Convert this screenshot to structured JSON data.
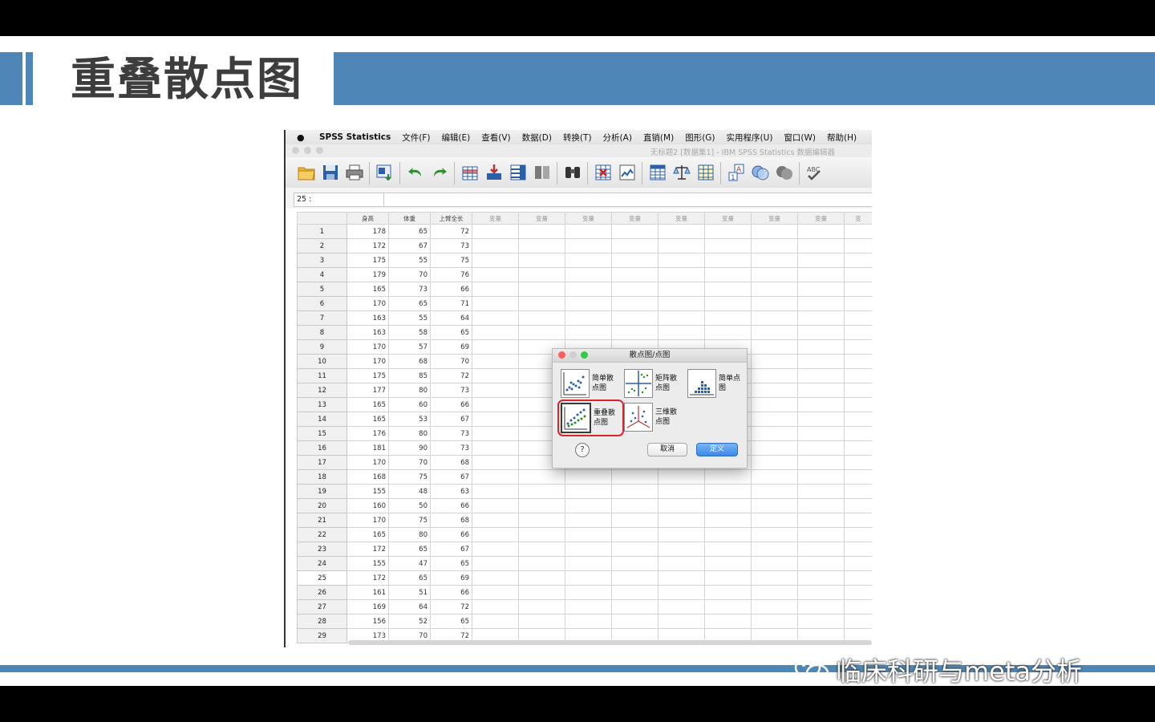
{
  "slide": {
    "title": "重叠散点图",
    "watermark": "临床科研与meta分析"
  },
  "menubar": {
    "app": "SPSS Statistics",
    "items": [
      "文件(F)",
      "编辑(E)",
      "查看(V)",
      "数据(D)",
      "转换(T)",
      "分析(A)",
      "直销(M)",
      "图形(G)",
      "实用程序(U)",
      "窗口(W)",
      "帮助(H)"
    ]
  },
  "window": {
    "title": "无标题2 [数据集1] - IBM SPSS Statistics 数据编辑器"
  },
  "cell_ref": "25 :",
  "grid": {
    "headers": [
      "身高",
      "体重",
      "上臂全长",
      "变量",
      "变量",
      "变量",
      "变量",
      "变量",
      "变量",
      "变量",
      "变量",
      "变"
    ],
    "active_row": "25",
    "rows": [
      {
        "n": "1",
        "v": [
          "178",
          "65",
          "72"
        ]
      },
      {
        "n": "2",
        "v": [
          "172",
          "67",
          "73"
        ]
      },
      {
        "n": "3",
        "v": [
          "175",
          "55",
          "75"
        ]
      },
      {
        "n": "4",
        "v": [
          "179",
          "70",
          "76"
        ]
      },
      {
        "n": "5",
        "v": [
          "165",
          "73",
          "66"
        ]
      },
      {
        "n": "6",
        "v": [
          "170",
          "65",
          "71"
        ]
      },
      {
        "n": "7",
        "v": [
          "163",
          "55",
          "64"
        ]
      },
      {
        "n": "8",
        "v": [
          "163",
          "58",
          "65"
        ]
      },
      {
        "n": "9",
        "v": [
          "170",
          "57",
          "69"
        ]
      },
      {
        "n": "10",
        "v": [
          "170",
          "68",
          "70"
        ]
      },
      {
        "n": "11",
        "v": [
          "175",
          "85",
          "72"
        ]
      },
      {
        "n": "12",
        "v": [
          "177",
          "80",
          "73"
        ]
      },
      {
        "n": "13",
        "v": [
          "165",
          "60",
          "66"
        ]
      },
      {
        "n": "14",
        "v": [
          "165",
          "53",
          "67"
        ]
      },
      {
        "n": "15",
        "v": [
          "176",
          "80",
          "73"
        ]
      },
      {
        "n": "16",
        "v": [
          "181",
          "90",
          "73"
        ]
      },
      {
        "n": "17",
        "v": [
          "170",
          "70",
          "68"
        ]
      },
      {
        "n": "18",
        "v": [
          "168",
          "75",
          "67"
        ]
      },
      {
        "n": "19",
        "v": [
          "155",
          "48",
          "63"
        ]
      },
      {
        "n": "20",
        "v": [
          "160",
          "50",
          "66"
        ]
      },
      {
        "n": "21",
        "v": [
          "170",
          "75",
          "68"
        ]
      },
      {
        "n": "22",
        "v": [
          "165",
          "80",
          "66"
        ]
      },
      {
        "n": "23",
        "v": [
          "172",
          "65",
          "67"
        ]
      },
      {
        "n": "24",
        "v": [
          "155",
          "47",
          "65"
        ]
      },
      {
        "n": "25",
        "v": [
          "172",
          "65",
          "69"
        ]
      },
      {
        "n": "26",
        "v": [
          "161",
          "51",
          "66"
        ]
      },
      {
        "n": "27",
        "v": [
          "169",
          "64",
          "72"
        ]
      },
      {
        "n": "28",
        "v": [
          "156",
          "52",
          "65"
        ]
      },
      {
        "n": "29",
        "v": [
          "173",
          "70",
          "72"
        ]
      }
    ]
  },
  "dialog": {
    "title": "散点图/点图",
    "options": {
      "simple_scatter": "简单散点图",
      "matrix_scatter": "矩阵散点图",
      "simple_dot": "简单点图",
      "overlay_scatter": "重叠散点图",
      "three_d_scatter": "三维散点图"
    },
    "help": "?",
    "cancel": "取消",
    "define": "定义",
    "selected": "overlay_scatter"
  },
  "colors": {
    "accent": "#4f86b8",
    "selection": "#d9252a",
    "define_button": "#3b88e8"
  }
}
